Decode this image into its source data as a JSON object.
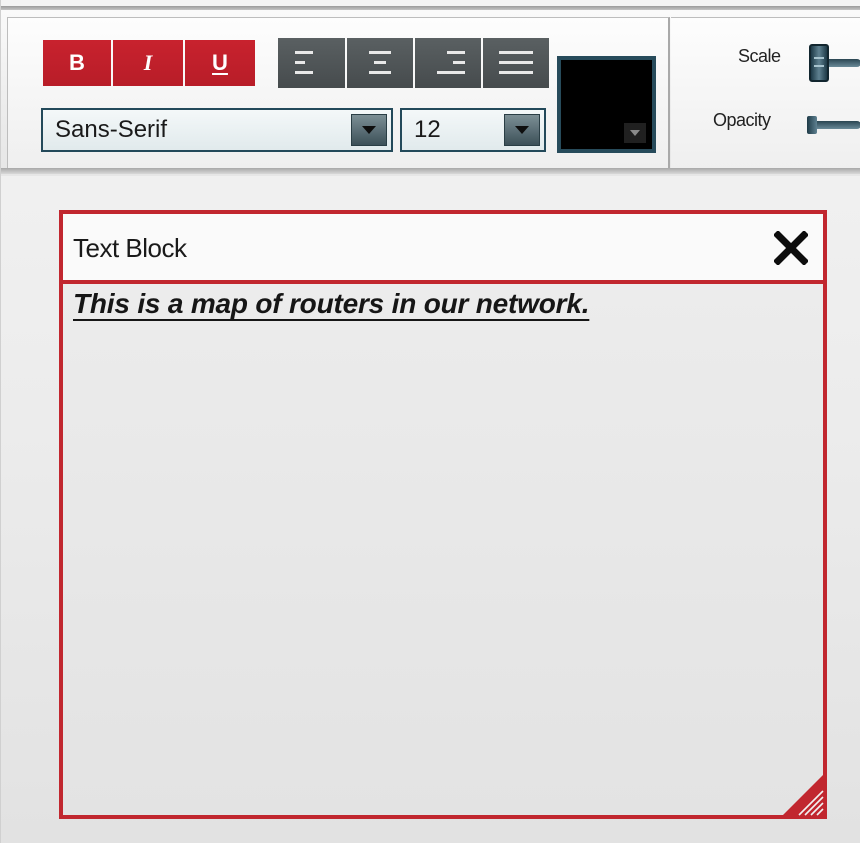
{
  "toolbar": {
    "bold_label": "B",
    "italic_label": "I",
    "underline_label": "U",
    "font_family": {
      "selected": "Sans-Serif"
    },
    "font_size": {
      "selected": "12"
    },
    "text_color": "#000000",
    "scale_label": "Scale",
    "opacity_label": "Opacity",
    "accent_color": "#c1272f",
    "align_button_color": "#4f5557"
  },
  "text_block": {
    "title": "Text Block",
    "content": "This is a map of routers in our network.",
    "border_color": "#c1272f"
  },
  "icons": {
    "align_left": "align-left-icon",
    "align_center": "align-center-icon",
    "align_right": "align-right-icon",
    "align_justify": "align-justify-icon",
    "dropdown": "chevron-down-icon",
    "close": "close-icon",
    "resize": "resize-grip-icon"
  }
}
